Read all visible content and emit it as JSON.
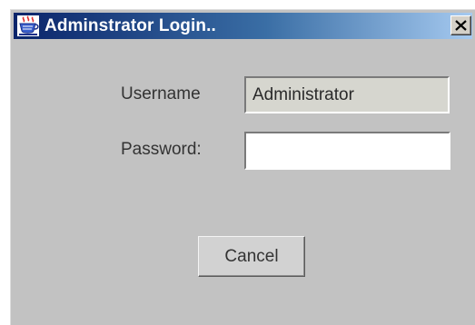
{
  "window": {
    "title": "Adminstrator Login..",
    "close_glyph": "✕",
    "app_icon": "java-cup-icon"
  },
  "form": {
    "username_label": "Username",
    "username_value": "Administrator",
    "password_label": "Password:",
    "password_value": ""
  },
  "buttons": {
    "cancel_label": "Cancel"
  },
  "colors": {
    "titlebar_start": "#0a246a",
    "titlebar_end": "#a6caf0",
    "window_bg": "#c2c2c2",
    "readonly_field_bg": "#d6d6cf"
  }
}
